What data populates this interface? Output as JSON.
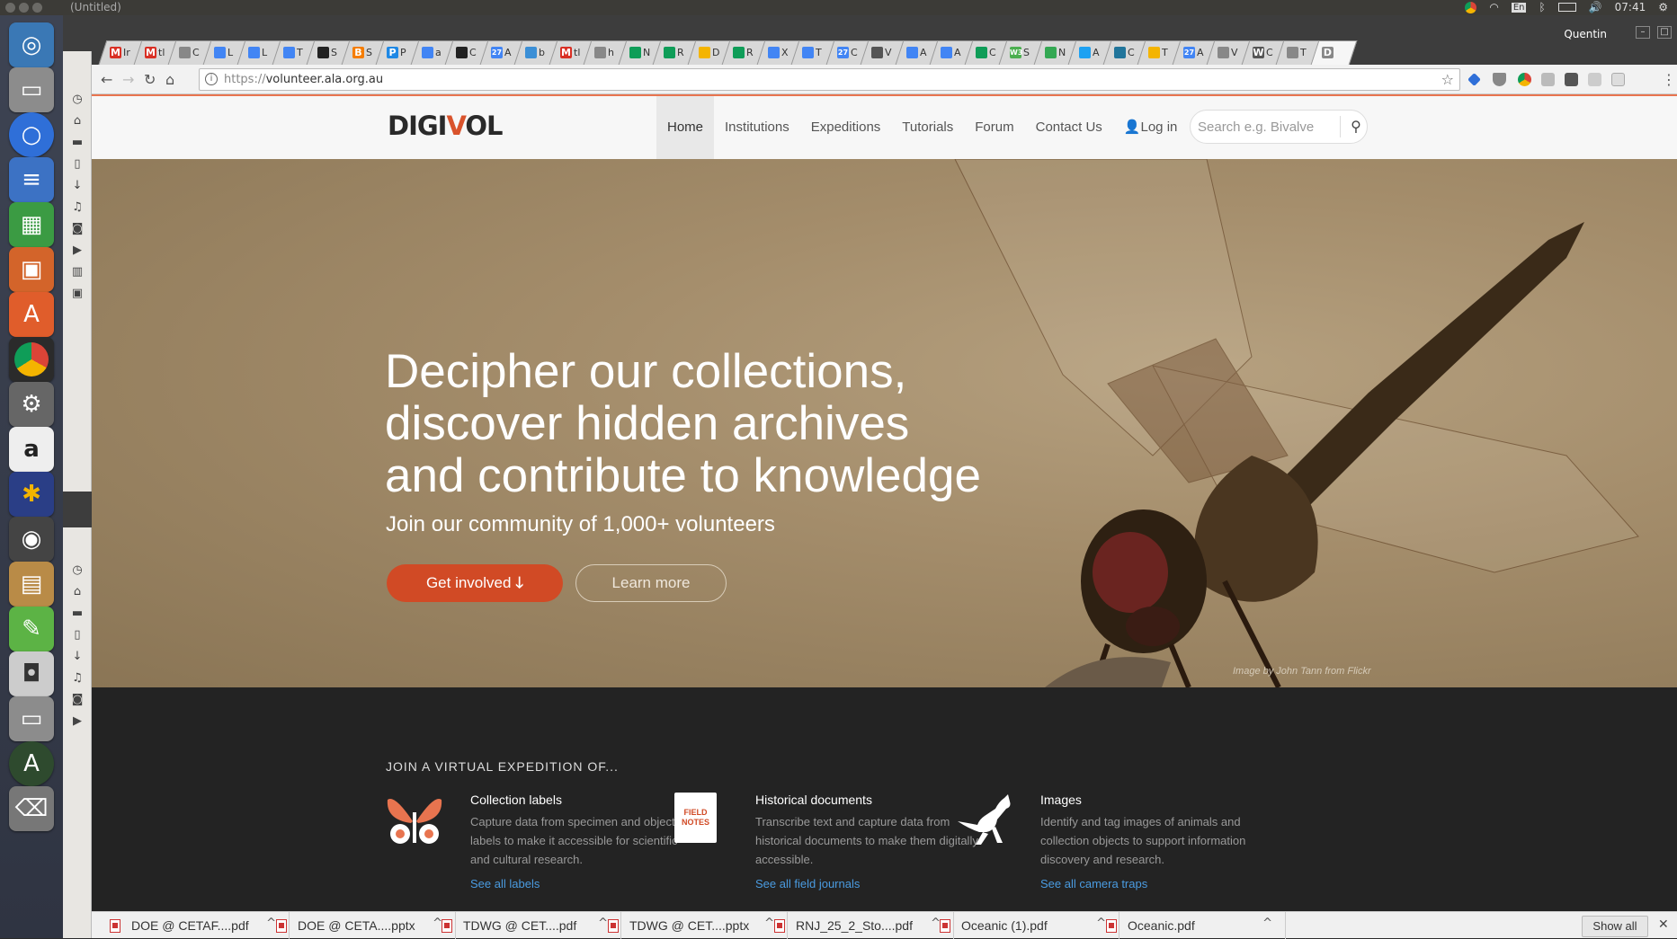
{
  "os_panel": {
    "window_title": "(Untitled)",
    "keyboard": "En",
    "time": "07:41"
  },
  "browser": {
    "profile": "Quentin",
    "tabs": [
      {
        "icon": "gmail-icon",
        "letter": "M",
        "label": "Ir",
        "color": "#d93025"
      },
      {
        "icon": "gmail-icon",
        "letter": "M",
        "label": "tl",
        "color": "#d93025"
      },
      {
        "icon": "page-icon",
        "letter": "",
        "label": "C",
        "color": "#888888"
      },
      {
        "icon": "docs-icon",
        "letter": "",
        "label": "L",
        "color": "#4285f4"
      },
      {
        "icon": "docs-icon",
        "letter": "",
        "label": "L",
        "color": "#4285f4"
      },
      {
        "icon": "docs-icon",
        "letter": "",
        "label": "T",
        "color": "#4285f4"
      },
      {
        "icon": "github-icon",
        "letter": "",
        "label": "S",
        "color": "#222222"
      },
      {
        "icon": "blogger-icon",
        "letter": "B",
        "label": "S",
        "color": "#f57d00"
      },
      {
        "icon": "pinboard-icon",
        "letter": "P",
        "label": "P",
        "color": "#1e88e5"
      },
      {
        "icon": "docs-icon",
        "letter": "",
        "label": "a",
        "color": "#4285f4"
      },
      {
        "icon": "github-icon",
        "letter": "",
        "label": "C",
        "color": "#222222"
      },
      {
        "icon": "calendar-icon",
        "letter": "27",
        "label": "A",
        "color": "#4285f4"
      },
      {
        "icon": "people-icon",
        "letter": "",
        "label": "b",
        "color": "#3b8fd6"
      },
      {
        "icon": "gmail-icon",
        "letter": "M",
        "label": "tl",
        "color": "#d93025"
      },
      {
        "icon": "page-icon",
        "letter": "",
        "label": "h",
        "color": "#888888"
      },
      {
        "icon": "drive-icon",
        "letter": "",
        "label": "N",
        "color": "#0f9d58"
      },
      {
        "icon": "drive-icon",
        "letter": "",
        "label": "R",
        "color": "#0f9d58"
      },
      {
        "icon": "slides-icon",
        "letter": "",
        "label": "D",
        "color": "#f4b400"
      },
      {
        "icon": "drive-icon",
        "letter": "",
        "label": "R",
        "color": "#0f9d58"
      },
      {
        "icon": "docs-icon",
        "letter": "",
        "label": "X",
        "color": "#4285f4"
      },
      {
        "icon": "docs-icon",
        "letter": "",
        "label": "T",
        "color": "#4285f4"
      },
      {
        "icon": "calendar-icon",
        "letter": "27",
        "label": "C",
        "color": "#4285f4"
      },
      {
        "icon": "sync-icon",
        "letter": "",
        "label": "V",
        "color": "#555555"
      },
      {
        "icon": "docs-icon",
        "letter": "",
        "label": "A",
        "color": "#4285f4"
      },
      {
        "icon": "docs-icon",
        "letter": "",
        "label": "A",
        "color": "#4285f4"
      },
      {
        "icon": "drive-icon",
        "letter": "",
        "label": "C",
        "color": "#0f9d58"
      },
      {
        "icon": "w3schools-icon",
        "letter": "W3",
        "label": "S",
        "color": "#4caf50"
      },
      {
        "icon": "maps-icon",
        "letter": "",
        "label": "N",
        "color": "#34a853"
      },
      {
        "icon": "bird-icon",
        "letter": "",
        "label": "A",
        "color": "#1da1f2"
      },
      {
        "icon": "wordpress-icon",
        "letter": "",
        "label": "C",
        "color": "#21759b"
      },
      {
        "icon": "slides-icon",
        "letter": "",
        "label": "T",
        "color": "#f4b400"
      },
      {
        "icon": "calendar-icon",
        "letter": "27",
        "label": "A",
        "color": "#4285f4"
      },
      {
        "icon": "page-icon",
        "letter": "",
        "label": "V",
        "color": "#888888"
      },
      {
        "icon": "wikipedia-icon",
        "letter": "W",
        "label": "C",
        "color": "#555555"
      },
      {
        "icon": "page-icon",
        "letter": "",
        "label": "T",
        "color": "#888888"
      },
      {
        "icon": "page-icon",
        "letter": "D",
        "label": "",
        "color": "#888888",
        "active": true
      }
    ],
    "url_scheme": "https://",
    "url_host": "volunteer.ala.org.au"
  },
  "site": {
    "logo_left": "DIGI",
    "logo_v": "V",
    "logo_right": "OL",
    "menu": [
      "Home",
      "Institutions",
      "Expeditions",
      "Tutorials",
      "Forum",
      "Contact Us"
    ],
    "login": "Log in",
    "search_placeholder": "Search e.g. Bivalve",
    "hero": {
      "line1": "Decipher our collections,",
      "line2": "discover hidden archives",
      "line3": "and contribute to knowledge",
      "subtitle": "Join our community of 1,000+ volunteers",
      "cta_primary": "Get involved",
      "cta_secondary": "Learn more",
      "credit": "Image by John Tann from Flickr"
    },
    "join_heading": "JOIN A VIRTUAL EXPEDITION OF...",
    "features": [
      {
        "title": "Collection labels",
        "text": "Capture data from specimen and object labels to make it accessible for scientific and cultural research.",
        "link": "See all labels",
        "icon": "butterfly-icon"
      },
      {
        "title": "Historical documents",
        "text": "Transcribe text and capture data from historical documents to make them digitally accessible.",
        "link": "See all field journals",
        "icon": "field-notes-icon",
        "icon_text": "FIELD NOTES"
      },
      {
        "title": "Images",
        "text": "Identify and tag images of animals and collection objects to support information discovery and research.",
        "link": "See all camera traps",
        "icon": "kangaroo-icon"
      }
    ]
  },
  "downloads": {
    "items": [
      "DOE @ CETAF....pdf",
      "DOE @ CETA....pptx",
      "TDWG @ CET....pdf",
      "TDWG @ CET....pptx",
      "RNJ_25_2_Sto....pdf",
      "Oceanic (1).pdf",
      "Oceanic.pdf"
    ],
    "show_all": "Show all"
  },
  "colors": {
    "accent": "#d14a25",
    "link": "#4a9be0",
    "dark_bg": "#232323"
  }
}
